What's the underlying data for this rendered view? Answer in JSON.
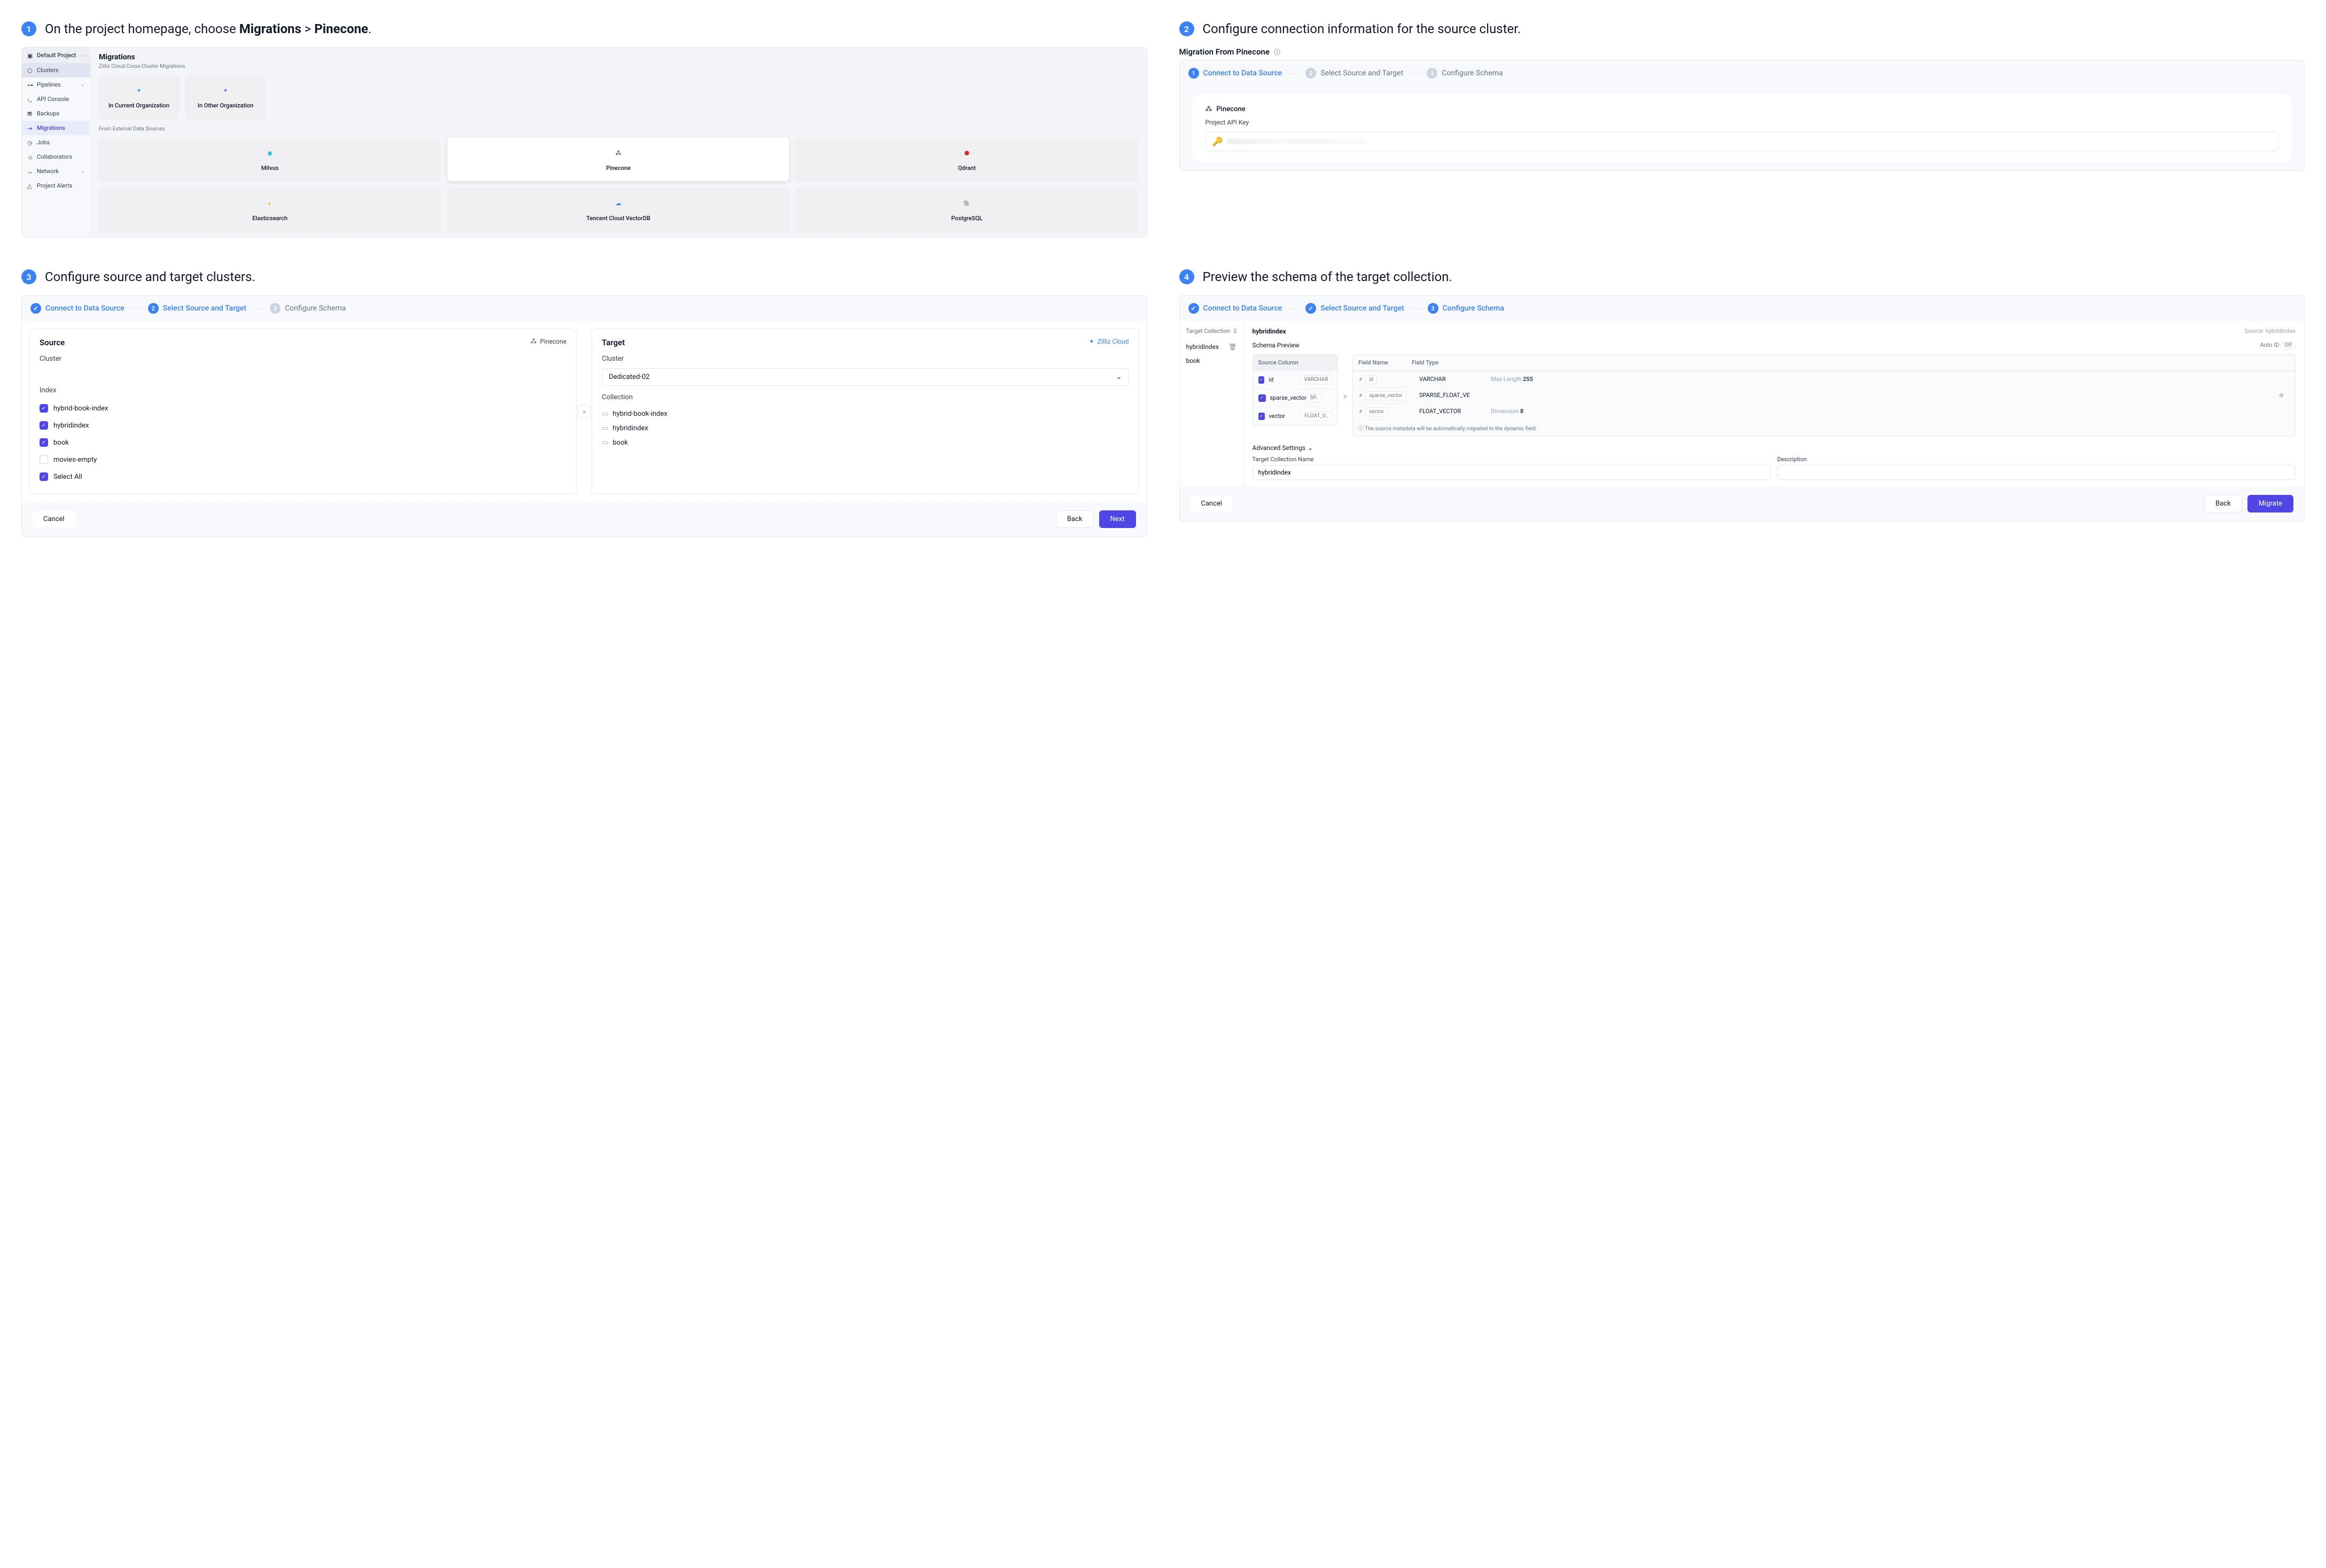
{
  "step1": {
    "num": "1",
    "title_pre": "On the project homepage, choose ",
    "title_b1": "Migrations",
    "title_sep": " > ",
    "title_b2": "Pinecone",
    "title_post": ".",
    "project": "Default Project",
    "sidebar": [
      "Clusters",
      "Pipelines",
      "API Console",
      "Backups",
      "Migrations",
      "Jobs",
      "Collaborators",
      "Network",
      "Project Alerts"
    ],
    "main_title": "Migrations",
    "sub1": "Zilliz Cloud Cross-Cluster Migrations",
    "tiles1": [
      "In Current Organization",
      "In Other Organization"
    ],
    "sub2": "From External Data Sources",
    "tiles2": [
      "Milvus",
      "Pinecone",
      "Qdrant",
      "Elasticsearch",
      "Tencent Cloud VectorDB",
      "PostgreSQL"
    ]
  },
  "step2": {
    "num": "2",
    "title": "Configure connection information for the source cluster.",
    "heading": "Migration From Pinecone",
    "wizard": [
      "Connect to Data Source",
      "Select Source and Target",
      "Configure Schema"
    ],
    "brand": "Pinecone",
    "api_label": "Project API Key"
  },
  "step3": {
    "num": "3",
    "title": "Configure source and target clusters.",
    "wizard": [
      "Connect to Data Source",
      "Select Source and Target",
      "Configure Schema"
    ],
    "source": {
      "h": "Source",
      "brand": "Pinecone",
      "cluster_label": "Cluster",
      "index_label": "Index",
      "indexes": [
        {
          "name": "hybrid-book-index",
          "on": true
        },
        {
          "name": "hybridindex",
          "on": true
        },
        {
          "name": "book",
          "on": true
        },
        {
          "name": "movies-empty",
          "on": false
        },
        {
          "name": "Select All",
          "on": true
        }
      ]
    },
    "target": {
      "h": "Target",
      "brand": "Zilliz Cloud",
      "cluster_label": "Cluster",
      "cluster_value": "Dedicated-02",
      "collection_label": "Collection",
      "collections": [
        "hybrid-book-index",
        "hybridindex",
        "book"
      ]
    },
    "footer": {
      "cancel": "Cancel",
      "back": "Back",
      "next": "Next"
    }
  },
  "step4": {
    "num": "4",
    "title": "Preview the schema of the target collection.",
    "wizard": [
      "Connect to Data Source",
      "Select Source and Target",
      "Configure Schema"
    ],
    "side": {
      "label": "Target Collection",
      "count": "2",
      "items": [
        "hybridindex",
        "book"
      ]
    },
    "main": {
      "name": "hybridindex",
      "source_label": "Source: hybridindex",
      "preview_label": "Schema Preview",
      "autoid_label": "Auto ID",
      "autoid_val": "Off",
      "src_head": "Source Column",
      "src_rows": [
        {
          "name": "id",
          "type": "VARCHAR"
        },
        {
          "name": "sparse_vector",
          "type": "SP.."
        },
        {
          "name": "vector",
          "type": "FLOAT_V.."
        }
      ],
      "tgt_head": [
        "Field Name",
        "Field Type"
      ],
      "tgt_rows": [
        {
          "name": "id",
          "type": "VARCHAR",
          "meta_k": "Max Length",
          "meta_v": "255"
        },
        {
          "name": "sparse_vector",
          "type": "SPARSE_FLOAT_VE"
        },
        {
          "name": "vector",
          "type": "FLOAT_VECTOR",
          "meta_k": "Dimension",
          "meta_v": "8"
        }
      ],
      "note": "The source metadata will be automatically migrated to the dynamic field.",
      "advanced": "Advanced Settings",
      "tcn_label": "Target Collection Name",
      "tcn_value": "hybridindex",
      "desc_label": "Description"
    },
    "footer": {
      "cancel": "Cancel",
      "back": "Back",
      "migrate": "Migrate"
    }
  }
}
